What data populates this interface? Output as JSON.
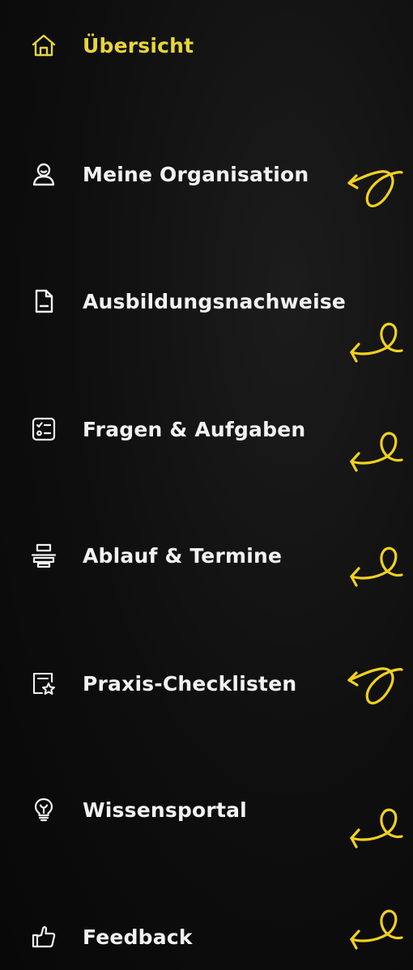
{
  "nav": {
    "accent_color": "#e8d53a",
    "text_color": "#f2f2f2",
    "items": [
      {
        "label": "Übersicht",
        "icon": "home-icon",
        "active": true
      },
      {
        "label": "Meine Organisation",
        "icon": "user-icon",
        "active": false
      },
      {
        "label": "Ausbildungsnachweise",
        "icon": "document-icon",
        "active": false
      },
      {
        "label": "Fragen & Aufgaben",
        "icon": "checklist-icon",
        "active": false
      },
      {
        "label": "Ablauf & Termine",
        "icon": "timeline-icon",
        "active": false
      },
      {
        "label": "Praxis-Checklisten",
        "icon": "star-list-icon",
        "active": false
      },
      {
        "label": "Wissensportal",
        "icon": "lightbulb-icon",
        "active": false
      },
      {
        "label": "Feedback",
        "icon": "thumbs-up-icon",
        "active": false
      }
    ]
  }
}
